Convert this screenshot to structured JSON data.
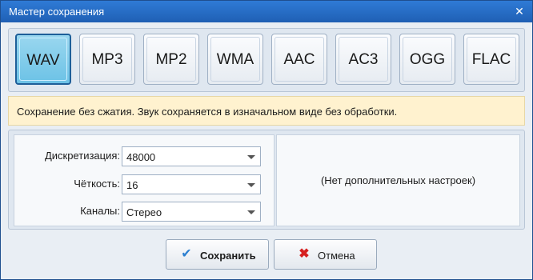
{
  "window": {
    "title": "Мастер сохранения",
    "close_glyph": "✕"
  },
  "formats": [
    {
      "label": "WAV",
      "active": true
    },
    {
      "label": "MP3"
    },
    {
      "label": "MP2"
    },
    {
      "label": "WMA"
    },
    {
      "label": "AAC"
    },
    {
      "label": "AC3"
    },
    {
      "label": "OGG"
    },
    {
      "label": "FLAC"
    }
  ],
  "info_text": "Сохранение без сжатия. Звук сохраняется в изначальном виде без обработки.",
  "settings": {
    "rows": [
      {
        "label": "Дискретизация:",
        "value": "48000"
      },
      {
        "label": "Чёткость:",
        "value": "16"
      },
      {
        "label": "Каналы:",
        "value": "Стерео"
      }
    ],
    "no_options_text": "(Нет дополнительных настроек)"
  },
  "buttons": {
    "save": {
      "label": "Сохранить",
      "icon": "checkmark-icon",
      "icon_color": "#2c7fd0"
    },
    "cancel": {
      "label": "Отмена",
      "icon": "x-icon",
      "icon_color": "#d62020"
    }
  },
  "colors": {
    "title_bar": "#2f7bd6",
    "active_format": "#6cc2e6",
    "info_bg": "#fff2cf"
  }
}
